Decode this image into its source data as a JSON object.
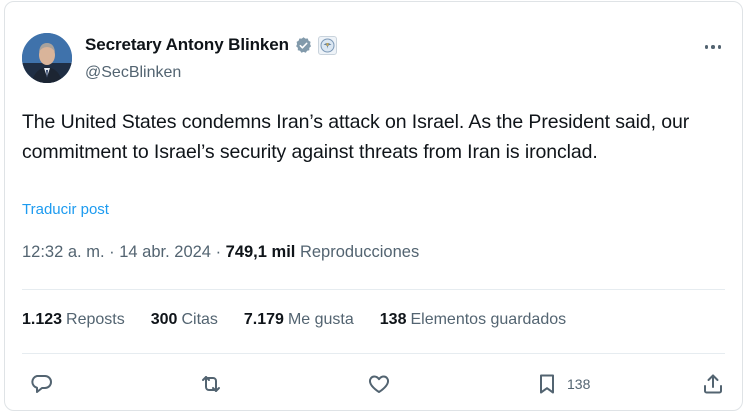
{
  "author": {
    "name": "Secretary Antony Blinken",
    "handle": "@SecBlinken",
    "verified_icon": "verified-badge-icon",
    "affiliate_icon": "state-department-seal-icon"
  },
  "tweet": {
    "text": "The United States condemns Iran’s attack on Israel.  As the President said, our commitment to Israel’s security against threats from Iran is ironclad.",
    "translate_label": "Traducir post"
  },
  "meta": {
    "time": "12:32 a. m.",
    "separator1": " · ",
    "date": "14 abr. 2024",
    "separator2": " · ",
    "views_count": "749,1 mil",
    "views_label": "Reproducciones"
  },
  "stats": {
    "reposts_count": "1.123",
    "reposts_label": "Reposts",
    "quotes_count": "300",
    "quotes_label": "Citas",
    "likes_count": "7.179",
    "likes_label": "Me gusta",
    "bookmarks_count": "138",
    "bookmarks_label": "Elementos guardados"
  },
  "actions": {
    "bookmark_count": "138"
  },
  "colors": {
    "link": "#1d9bf0",
    "secondary_text": "#536471",
    "primary_text": "#0f1419",
    "verified_badge": "#829aab"
  }
}
